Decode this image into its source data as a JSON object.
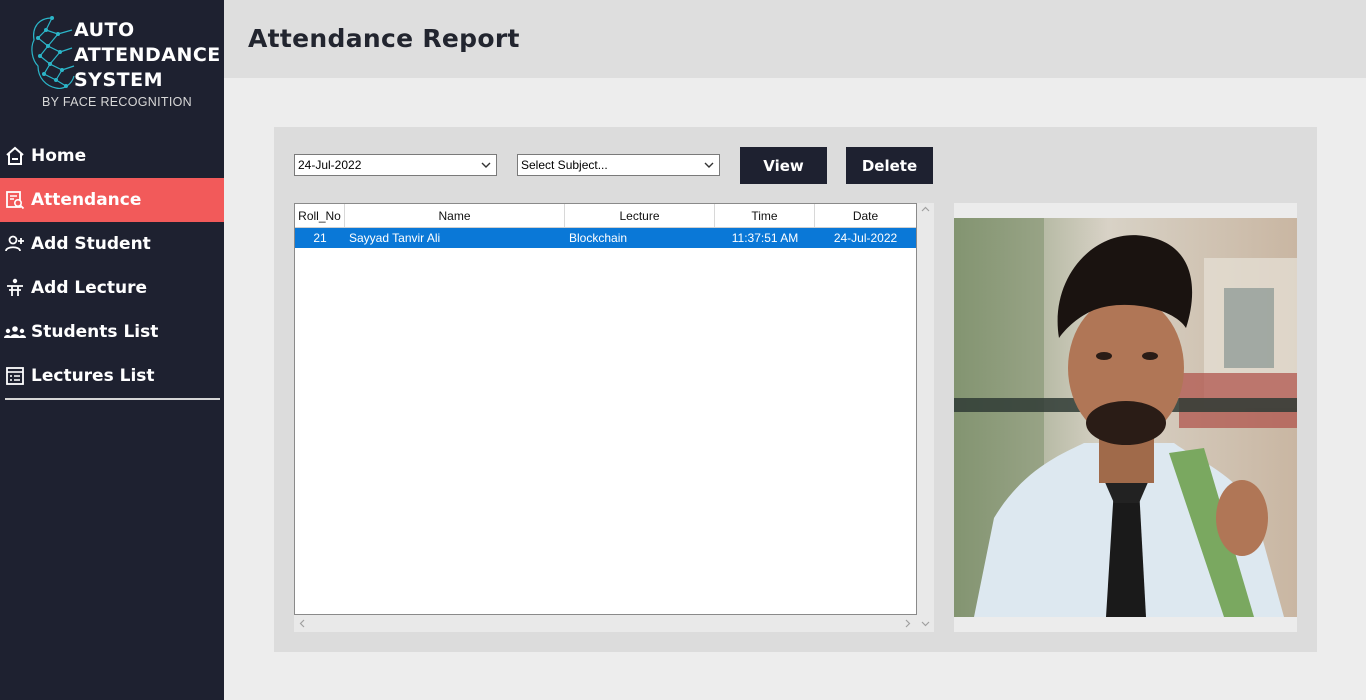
{
  "sidebar": {
    "logo": {
      "line1": "AUTO",
      "line2": "ATTENDANCE",
      "line3": "SYSTEM",
      "subtitle": "BY FACE RECOGNITION"
    },
    "items": [
      {
        "label": "Home",
        "icon": "home-icon",
        "active": false
      },
      {
        "label": "Attendance",
        "icon": "attendance-search-icon",
        "active": true
      },
      {
        "label": "Add Student",
        "icon": "add-user-icon",
        "active": false
      },
      {
        "label": "Add Lecture",
        "icon": "lecture-desk-icon",
        "active": false
      },
      {
        "label": "Students List",
        "icon": "group-icon",
        "active": false
      },
      {
        "label": "Lectures List",
        "icon": "list-icon",
        "active": false
      }
    ]
  },
  "header": {
    "title": "Attendance Report"
  },
  "filters": {
    "date_value": "24-Jul-2022",
    "subject_value": "Select Subject...",
    "view_label": "View",
    "delete_label": "Delete"
  },
  "table": {
    "columns": [
      "Roll_No",
      "Name",
      "Lecture",
      "Time",
      "Date"
    ],
    "rows": [
      {
        "roll": "21",
        "name": "Sayyad Tanvir Ali",
        "lecture": "Blockchain",
        "time": "11:37:51 AM",
        "date": "24-Jul-2022",
        "selected": true
      }
    ]
  },
  "colors": {
    "sidebar_bg": "#1e2130",
    "active_item": "#f25a5a",
    "selection": "#0a78d7",
    "button_bg": "#1e2130"
  }
}
